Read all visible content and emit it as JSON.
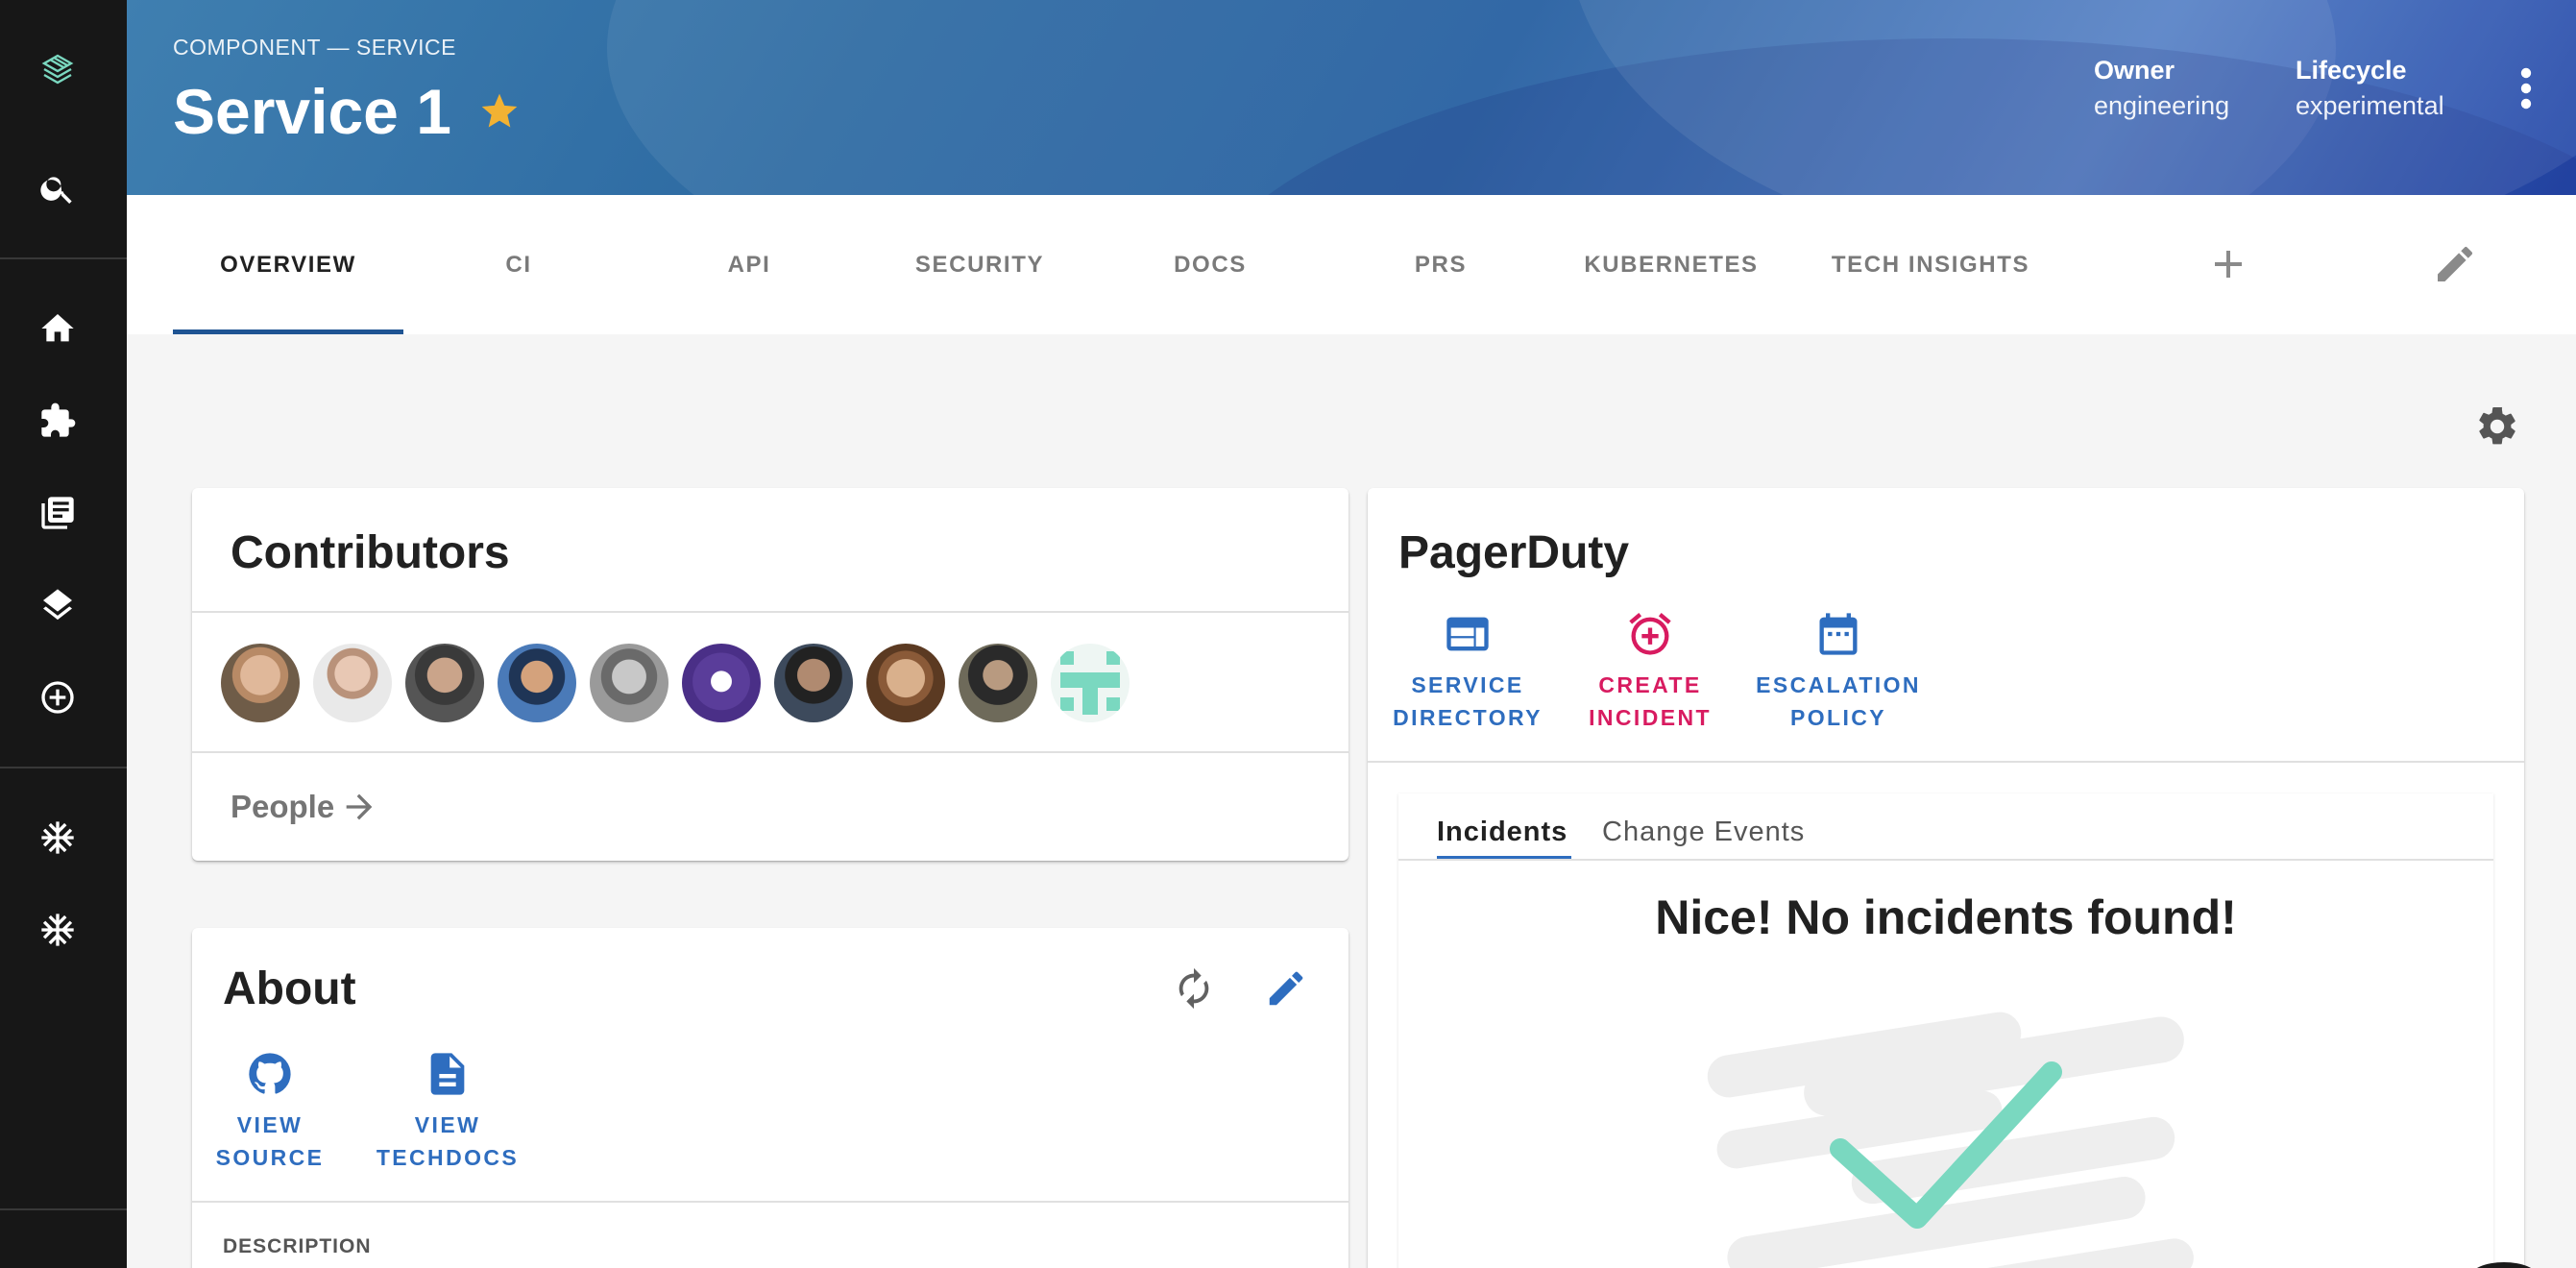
{
  "sidebar": {
    "items": [
      {
        "name": "logo-icon"
      },
      {
        "name": "search-icon"
      },
      {
        "name": "home-icon"
      },
      {
        "name": "puzzle-icon"
      },
      {
        "name": "library-icon"
      },
      {
        "name": "layers-icon"
      },
      {
        "name": "add-circle-icon"
      },
      {
        "name": "snowflake-icon"
      },
      {
        "name": "snowflake-icon"
      }
    ]
  },
  "header": {
    "breadcrumb": "COMPONENT — SERVICE",
    "title": "Service 1",
    "owner_label": "Owner",
    "owner_value": "engineering",
    "lifecycle_label": "Lifecycle",
    "lifecycle_value": "experimental"
  },
  "tabs": [
    {
      "label": "OVERVIEW",
      "active": true
    },
    {
      "label": "CI"
    },
    {
      "label": "API"
    },
    {
      "label": "SECURITY"
    },
    {
      "label": "DOCS"
    },
    {
      "label": "PRS"
    },
    {
      "label": "KUBERNETES"
    },
    {
      "label": "TECH INSIGHTS"
    }
  ],
  "contributors": {
    "title": "Contributors",
    "people_link": "People"
  },
  "about": {
    "title": "About",
    "view_source": "VIEW SOURCE",
    "view_techdocs": "VIEW TECHDOCS",
    "description_label": "DESCRIPTION"
  },
  "pagerduty": {
    "title": "PagerDuty",
    "service_directory": "SERVICE DIRECTORY",
    "create_incident": "CREATE INCIDENT",
    "escalation_policy": "ESCALATION POLICY",
    "tab_incidents": "Incidents",
    "tab_change_events": "Change Events",
    "empty_message": "Nice! No incidents found!"
  },
  "colors": {
    "accent": "#2e6dbf",
    "star": "#f2b233",
    "create_incident": "#d81b60",
    "check": "#7ad8c0"
  }
}
